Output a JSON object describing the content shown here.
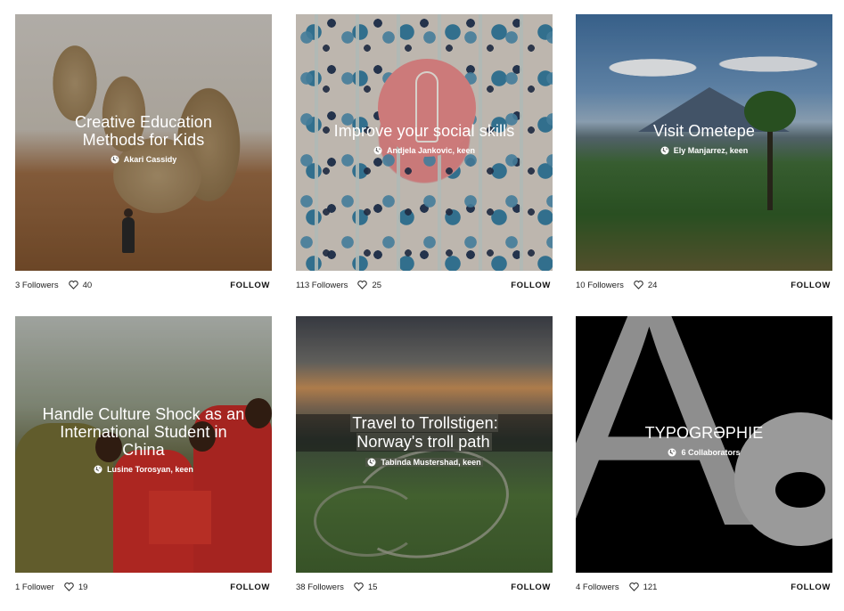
{
  "follow_label": "FOLLOW",
  "cards": [
    {
      "title": "Creative Education Methods for Kids",
      "byline": "Akari Cassidy",
      "followers": "3 Followers",
      "likes": "40"
    },
    {
      "title": "Improve your social skills",
      "byline": "Andjela Jankovic, keen",
      "followers": "113 Followers",
      "likes": "25"
    },
    {
      "title": "Visit Ometepe",
      "byline": "Ely Manjarrez, keen",
      "followers": "10 Followers",
      "likes": "24"
    },
    {
      "title": "Handle Culture Shock as an International Student in China",
      "byline": "Lusine Torosyan, keen",
      "followers": "1 Follower",
      "likes": "19"
    },
    {
      "title": "Travel to Trollstigen: Norway's troll path",
      "byline": "Tabinda Mustershad, keen",
      "followers": "38 Followers",
      "likes": "15"
    },
    {
      "title": "TYPOGRƏPHIE",
      "byline": "6 Collaborators",
      "followers": "4 Followers",
      "likes": "121"
    }
  ],
  "icons": {
    "byline": "globe-icon",
    "likes": "heart-icon"
  },
  "colors": {
    "text": "#111111",
    "overlay_text": "#ffffff",
    "background": "#ffffff"
  }
}
